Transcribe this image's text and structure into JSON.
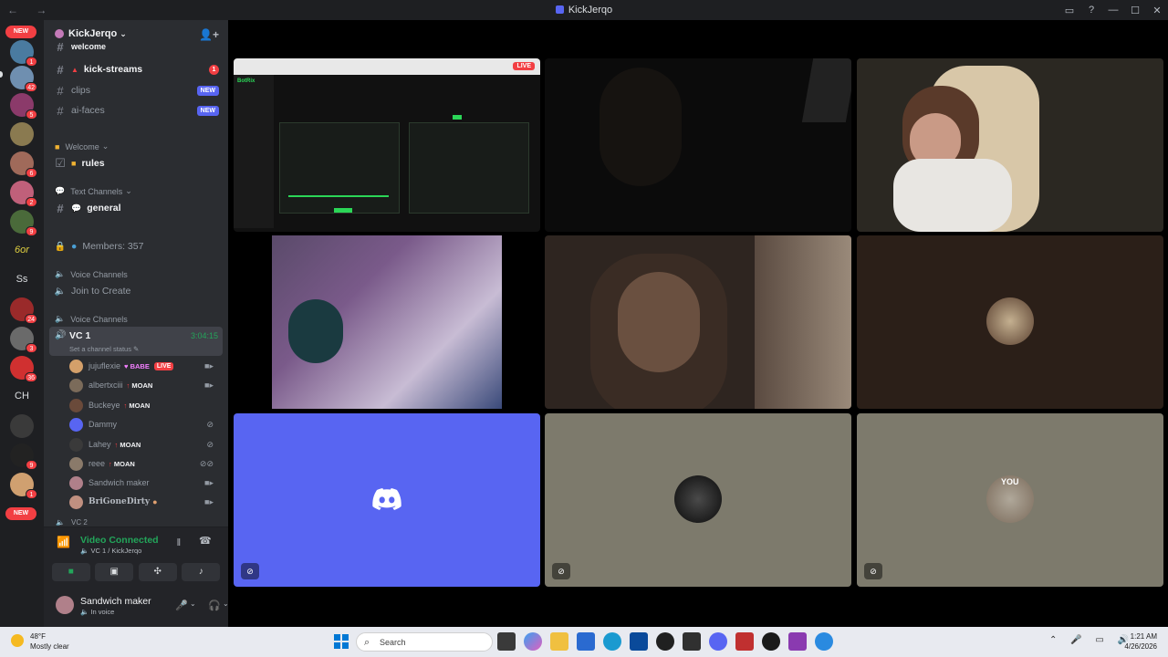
{
  "window": {
    "title": "KickJerqo",
    "nav_back": "←",
    "nav_fwd": "→"
  },
  "server_rail": {
    "new_top": "NEW",
    "new_bottom": "NEW",
    "badges": [
      "1",
      "42",
      "5",
      "6",
      "2",
      "9",
      "24",
      "3",
      "36",
      "53",
      "9",
      "1"
    ],
    "text_icons": [
      "Ss",
      "CH",
      "6or"
    ]
  },
  "guild": {
    "name": "KickJerqo",
    "chevron": "⌄"
  },
  "channels": {
    "welcome_partial": "welcome",
    "kick_streams": {
      "label": "kick-streams",
      "badge": "1"
    },
    "clips": {
      "label": "clips",
      "tag": "NEW"
    },
    "ai_faces": {
      "label": "ai-faces",
      "tag": "NEW"
    },
    "cat_welcome": "Welcome",
    "rules": "rules",
    "cat_text": "Text Channels",
    "general": "general",
    "members": "Members: 357",
    "cat_voice1": "Voice Channels",
    "join_to_create": "Join to Create",
    "cat_voice2": "Voice Channels",
    "vc1": {
      "name": "VC 1",
      "timer": "3:04:15",
      "status": "Set a channel status"
    },
    "vc2_partial": "VC 2"
  },
  "members": [
    {
      "name": "jujuflexie",
      "tag": "BABE",
      "live": "LIVE",
      "color": "#d4a06a"
    },
    {
      "name": "albertxciii",
      "tag": "MOAN",
      "color": "#7b6b5a"
    },
    {
      "name": "Buckeye",
      "tag": "MOAN",
      "color": "#6a4a3a"
    },
    {
      "name": "Dammy",
      "tag": "",
      "color": "#5865f2"
    },
    {
      "name": "Lahey",
      "tag": "MOAN",
      "color": "#3a3a3a"
    },
    {
      "name": "reee",
      "tag": "MOAN",
      "color": "#8a7a6a"
    },
    {
      "name": "Sandwich maker",
      "tag": "",
      "color": "#b0808a"
    },
    {
      "name": "BriGoneDirty",
      "tag": "",
      "color": "#c09080"
    }
  ],
  "voice_panel": {
    "status": "Video Connected",
    "location": "VC 1 / KickJerqo"
  },
  "user": {
    "name": "Sandwich maker",
    "status": "In voice"
  },
  "stage": {
    "screenshare_live": "LIVE",
    "you_label": "YOU",
    "screenshare_app": "BotRix"
  },
  "taskbar": {
    "temp": "48°F",
    "weather": "Mostly clear",
    "search_placeholder": "Search",
    "time": "1:21 AM",
    "date": "4/26/2026"
  },
  "colors": {
    "blurple": "#5865f2",
    "green": "#23a55a",
    "red": "#f23f43",
    "tile_tan": "#7d7a6c",
    "tile_brown": "#2b1f18"
  }
}
